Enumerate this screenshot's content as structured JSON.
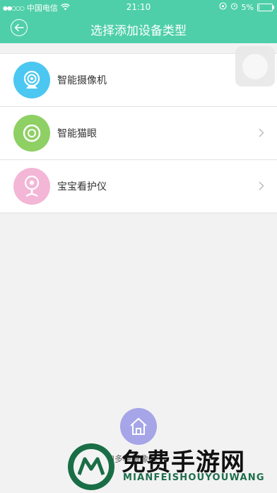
{
  "status_bar": {
    "signal_dots": "●●○○○",
    "carrier": "中国电信",
    "time": "21:10",
    "battery_text": "5%",
    "battery_level": 0.05
  },
  "nav": {
    "title": "选择添加设备类型"
  },
  "device_types": [
    {
      "label": "智能摄像机",
      "icon": "camera-icon",
      "color": "#4cc7f2"
    },
    {
      "label": "智能猫眼",
      "icon": "peephole-icon",
      "color": "#8fd065"
    },
    {
      "label": "宝宝看护仪",
      "icon": "baby-monitor-icon",
      "color": "#f3b6d6"
    }
  ],
  "bottom": {
    "home_icon": "home-icon",
    "caption": "加多种摄像机"
  },
  "watermark": {
    "brand": "免费手游网",
    "url_text": "MIANFEISHOUYOUWANG"
  }
}
